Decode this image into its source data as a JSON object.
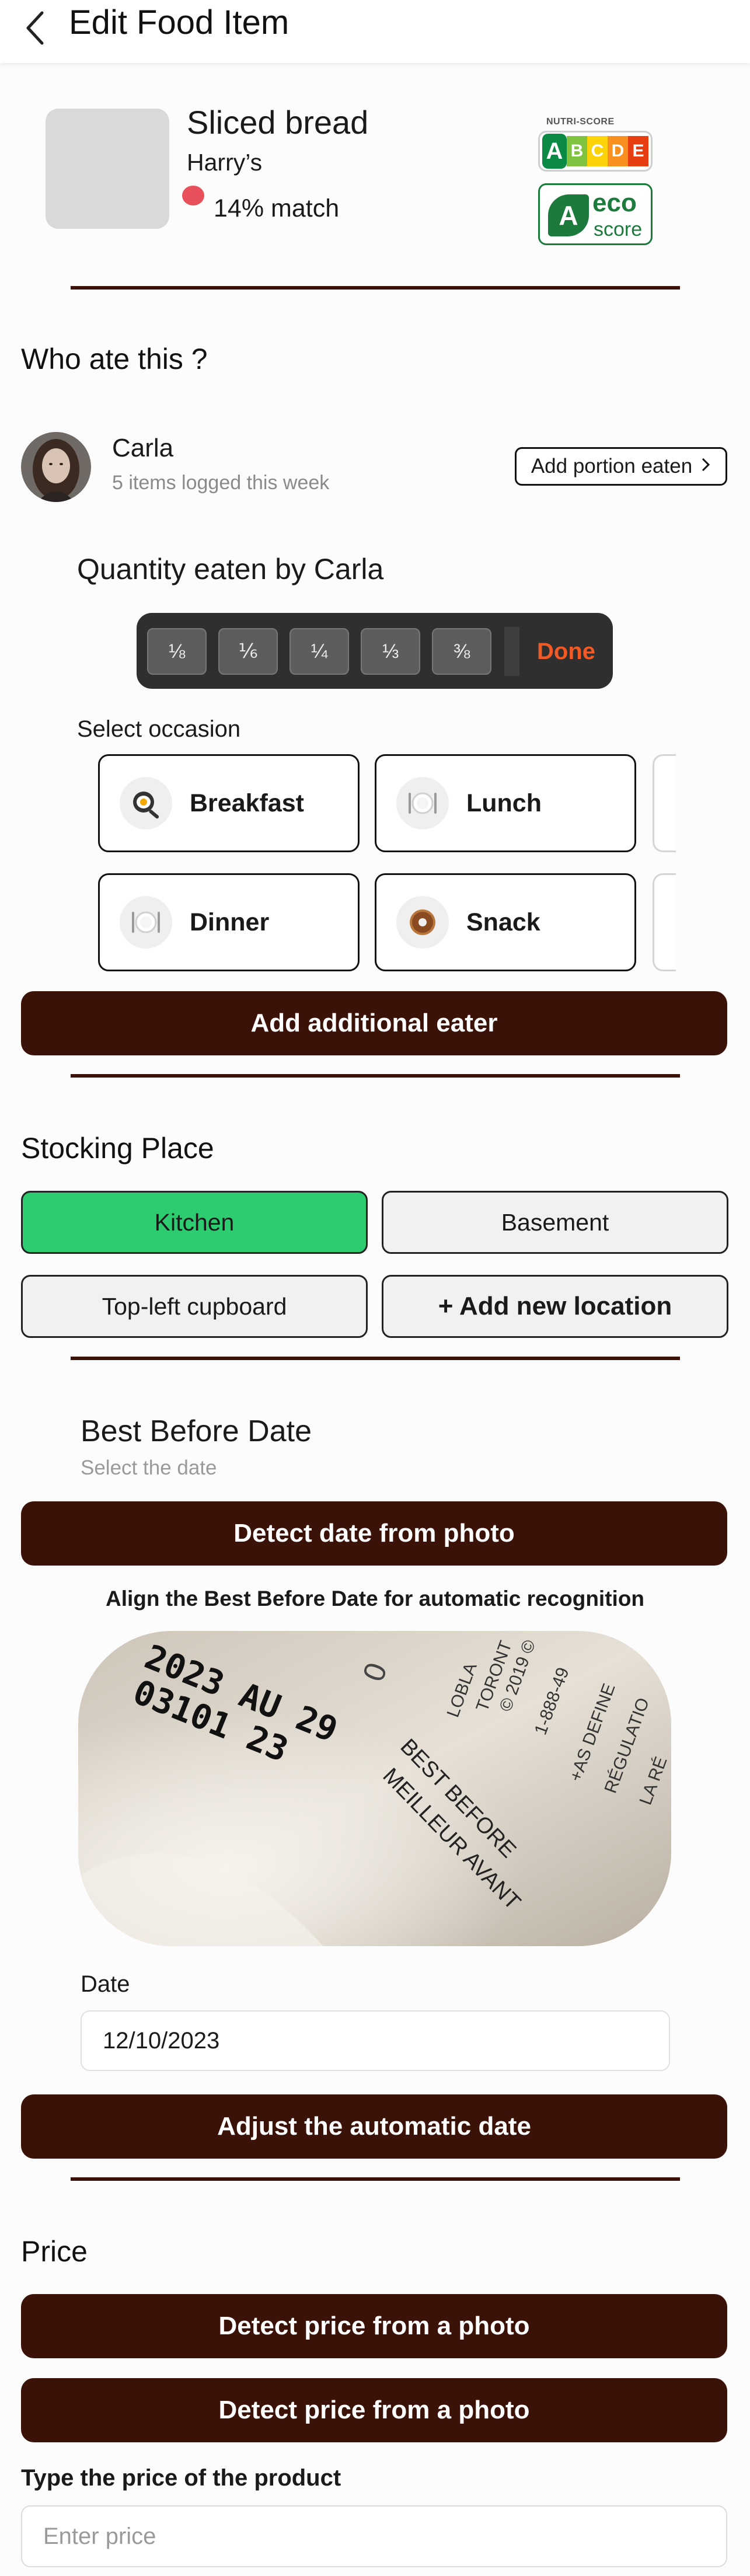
{
  "header": {
    "title": "Edit Food Item",
    "back_icon": "chevron-left-icon"
  },
  "product": {
    "name": "Sliced bread",
    "brand": "Harry’s",
    "match": "14% match",
    "match_color": "#e8505b",
    "nutri_score": {
      "label": "NUTRI-SCORE",
      "grades": [
        "A",
        "B",
        "C",
        "D",
        "E"
      ],
      "selected": "A"
    },
    "eco_score": {
      "grade": "A",
      "word": "eco",
      "sub": "score"
    }
  },
  "who_ate": {
    "title": "Who ate this ?",
    "eater": {
      "name": "Carla",
      "subtitle": "5 items logged this week"
    },
    "portion_button": "Add portion eaten",
    "quantity_title": "Quantity eaten by Carla",
    "fractions": [
      "⅛",
      "⅙",
      "¼",
      "⅓",
      "⅜"
    ],
    "done_label": "Done",
    "occasion_label": "Select occasion",
    "occasions": [
      {
        "label": "Breakfast",
        "icon": "frying-pan-egg-icon"
      },
      {
        "label": "Lunch",
        "icon": "plate-cutlery-icon"
      },
      {
        "label": "Dinner",
        "icon": "plate-cutlery-icon"
      },
      {
        "label": "Snack",
        "icon": "donut-icon"
      }
    ],
    "add_eater_button": "Add additional eater"
  },
  "stocking": {
    "title": "Stocking Place",
    "locations": [
      {
        "label": "Kitchen",
        "active": true
      },
      {
        "label": "Basement",
        "active": false
      },
      {
        "label": "Top-left cupboard",
        "active": false
      }
    ],
    "add_location": "+ Add new location"
  },
  "best_before": {
    "title": "Best Before Date",
    "subtitle": "Select the date",
    "detect_button": "Detect date from photo",
    "align_text": "Align the Best Before Date for automatic recognition",
    "photo_text": {
      "line1": "2023 AU 29",
      "line2": "03101 23",
      "line3": "BEST BEFORE",
      "line4": "MEILLEUR AVANT",
      "side_text": [
        "LOBLA",
        "TORONT",
        "© 2019 ©",
        "1-888-49",
        "+AS DEFINE",
        "RÉGULATIO",
        "LA RÉ"
      ]
    },
    "date_label": "Date",
    "date_value": "12/10/2023",
    "adjust_button": "Adjust the automatic date"
  },
  "price": {
    "title": "Price",
    "detect_button_1": "Detect price from a photo",
    "detect_button_2": "Detect price from a photo",
    "input_label": "Type the price of the product",
    "input_placeholder": "Enter price"
  },
  "colors": {
    "primary": "#3b1208",
    "active_location": "#2dcc70",
    "done": "#f15a24"
  }
}
